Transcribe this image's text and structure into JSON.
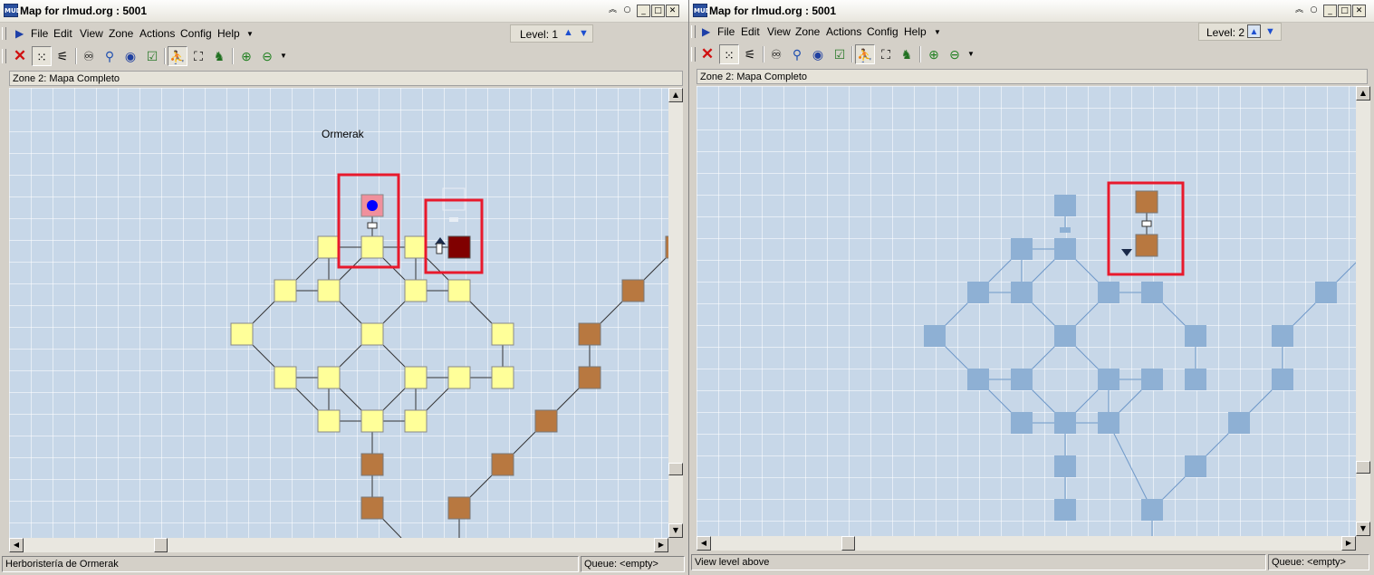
{
  "windows": [
    {
      "title": "Map for rlmud.org : 5001",
      "menu": [
        "File",
        "Edit",
        "View",
        "Zone",
        "Actions",
        "Config",
        "Help"
      ],
      "level_label": "Level: 1",
      "zone_label": "Zone 2: Mapa Completo",
      "map_label": "Ormerak",
      "status_left": "Herboristería de Ormerak",
      "status_right": "Queue: <empty>"
    },
    {
      "title": "Map for rlmud.org : 5001",
      "menu": [
        "File",
        "Edit",
        "View",
        "Zone",
        "Actions",
        "Config",
        "Help"
      ],
      "level_label": "Level: 2",
      "zone_label": "Zone 2: Mapa Completo",
      "status_left": "View level above",
      "status_right": "Queue: <empty>"
    }
  ],
  "colors": {
    "room_yellow": "#ffff99",
    "room_brown": "#b87840",
    "room_dark_red": "#800000",
    "room_faded": "#8eb0d4",
    "room_current_pink": "#f0909c",
    "player_dot": "#0000ff",
    "highlight_red": "#e8192c",
    "map_bg": "#c7d7e8"
  },
  "icons": {
    "toolbar": [
      "close-icon",
      "grid-icon",
      "spray-icon",
      "binoculars-icon",
      "magnifier-icon",
      "find-room-icon",
      "checkbox-icon",
      "follow-icon",
      "walk-icon",
      "walker-icon",
      "zoom-in-icon",
      "zoom-out-icon",
      "dropdown-icon"
    ]
  }
}
